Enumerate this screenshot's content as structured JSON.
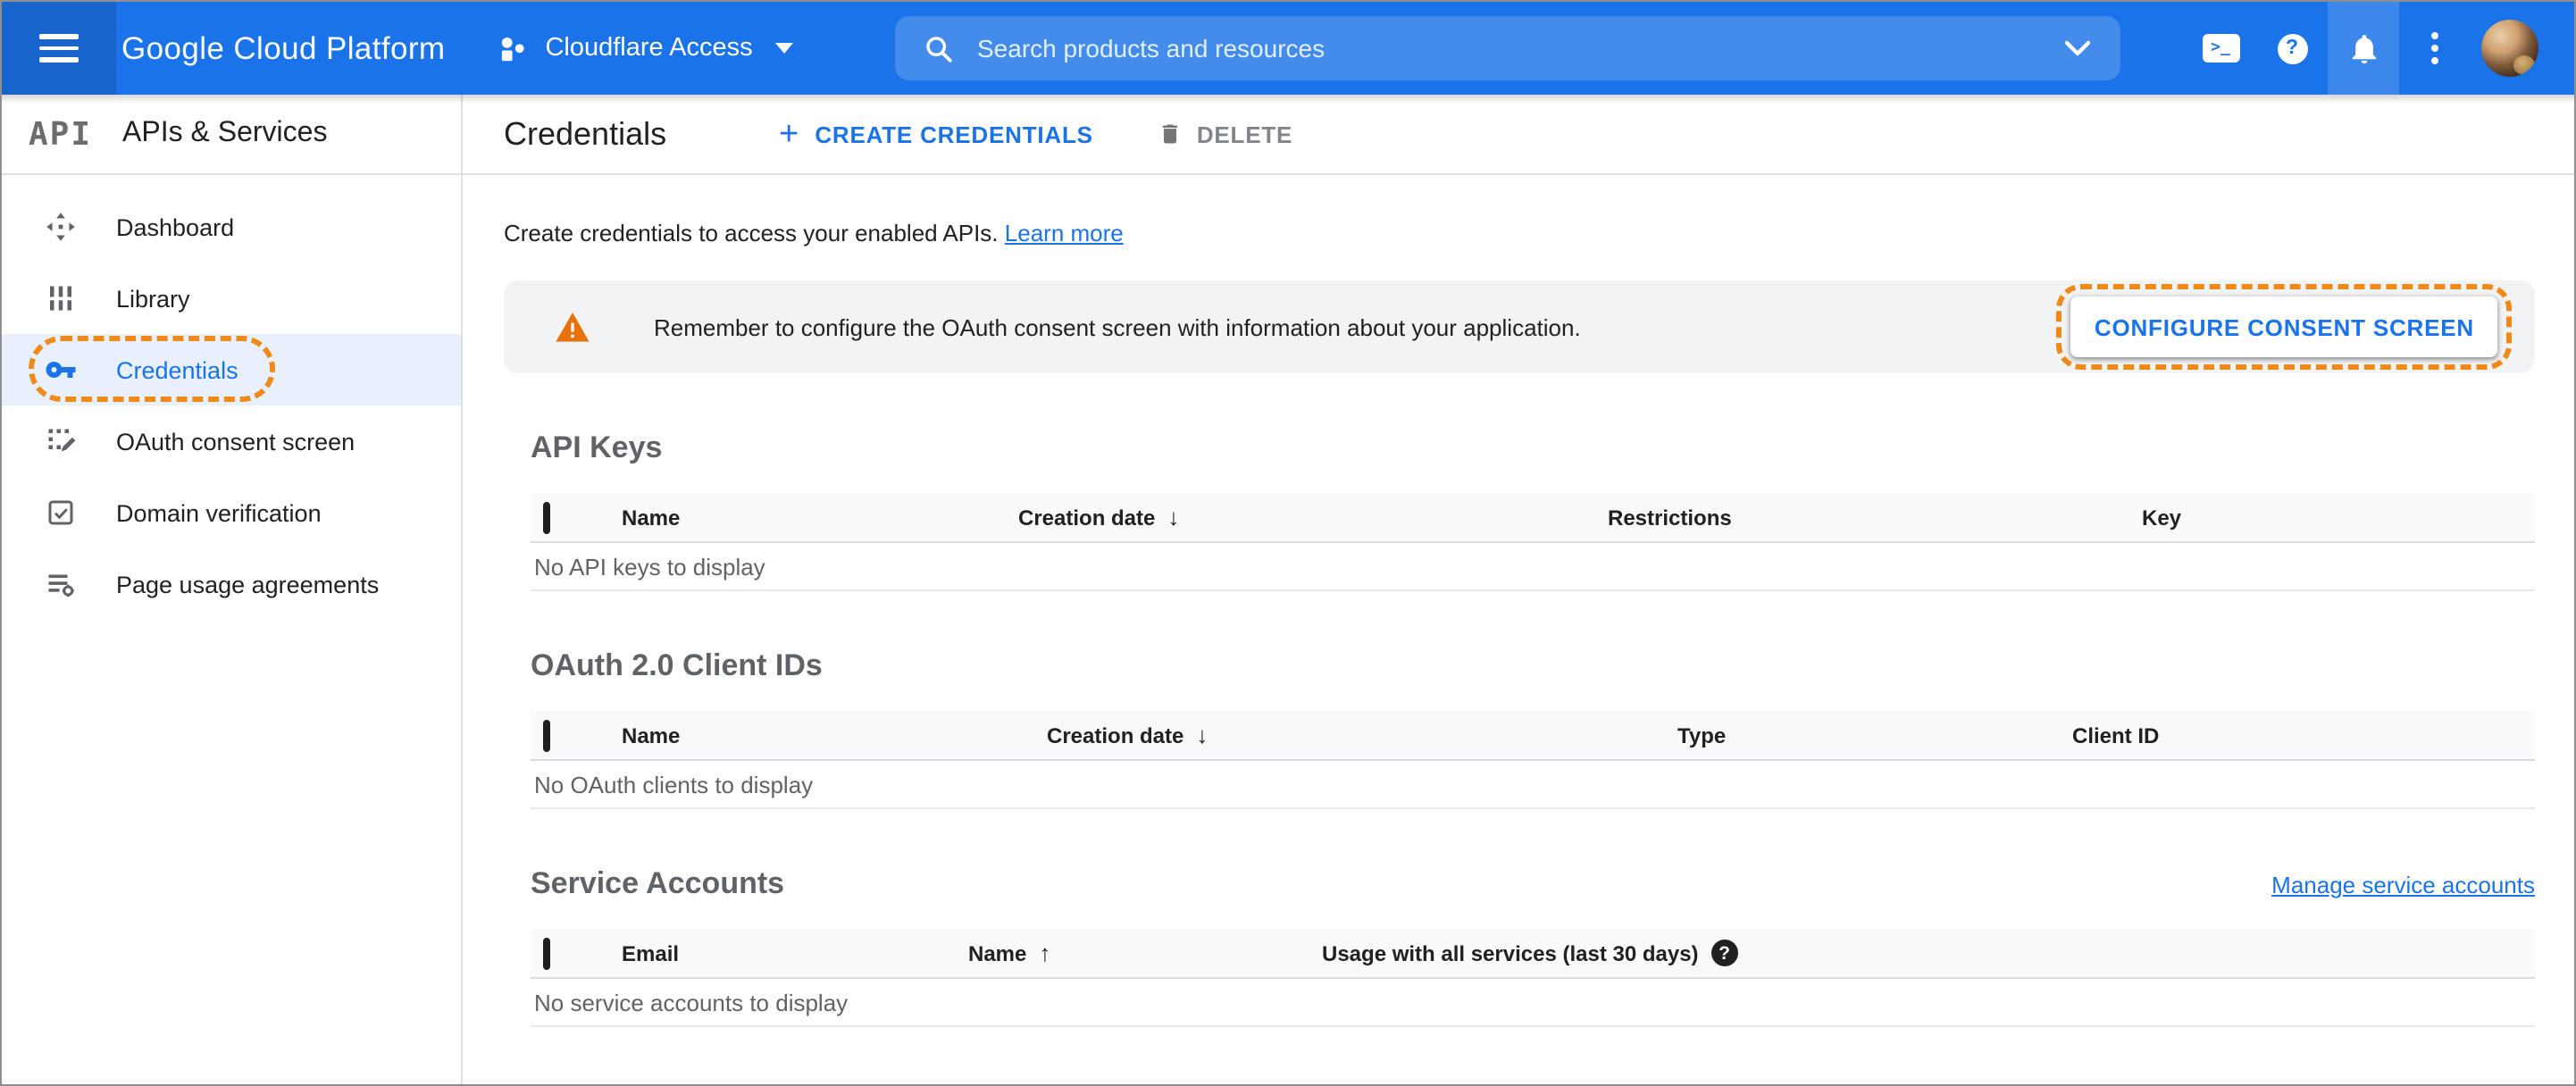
{
  "topbar": {
    "product_name": "Google Cloud Platform",
    "project_name": "Cloudflare Access",
    "search_placeholder": "Search products and resources"
  },
  "sidebar": {
    "logo_text": "API",
    "title": "APIs & Services",
    "items": [
      {
        "label": "Dashboard"
      },
      {
        "label": "Library"
      },
      {
        "label": "Credentials"
      },
      {
        "label": "OAuth consent screen"
      },
      {
        "label": "Domain verification"
      },
      {
        "label": "Page usage agreements"
      }
    ],
    "active_item": "Credentials"
  },
  "header": {
    "title": "Credentials",
    "create_label": "CREATE CREDENTIALS",
    "delete_label": "DELETE"
  },
  "main": {
    "intro_text": "Create credentials to access your enabled APIs.",
    "learn_more_label": "Learn more",
    "banner": {
      "message": "Remember to configure the OAuth consent screen with information about your application.",
      "button_label": "CONFIGURE CONSENT SCREEN"
    },
    "api_keys": {
      "title": "API Keys",
      "columns": [
        "Name",
        "Creation date",
        "Restrictions",
        "Key"
      ],
      "sorted_by": "Creation date",
      "sort_direction": "descending",
      "empty_text": "No API keys to display"
    },
    "oauth_clients": {
      "title": "OAuth 2.0 Client IDs",
      "columns": [
        "Name",
        "Creation date",
        "Type",
        "Client ID"
      ],
      "sorted_by": "Creation date",
      "sort_direction": "descending",
      "empty_text": "No OAuth clients to display"
    },
    "service_accounts": {
      "title": "Service Accounts",
      "manage_link_label": "Manage service accounts",
      "columns": [
        "Email",
        "Name",
        "Usage with all services (last 30 days)"
      ],
      "sorted_by": "Name",
      "sort_direction": "ascending",
      "empty_text": "No service accounts to display"
    }
  },
  "icons": {
    "sort_desc": "↓",
    "sort_asc": "↑",
    "help_glyph": "?",
    "plus_glyph": "+",
    "terminal_glyph": ">_"
  },
  "colors": {
    "topbar_blue": "#1a73e8",
    "topbar_dark_blue": "#1765cc",
    "accent_blue": "#1a73e8",
    "annotation_orange": "#ef8a1a",
    "warning_orange": "#e8710a",
    "banner_bg": "#f1f3f4",
    "active_item_bg": "#e8f0fe"
  }
}
